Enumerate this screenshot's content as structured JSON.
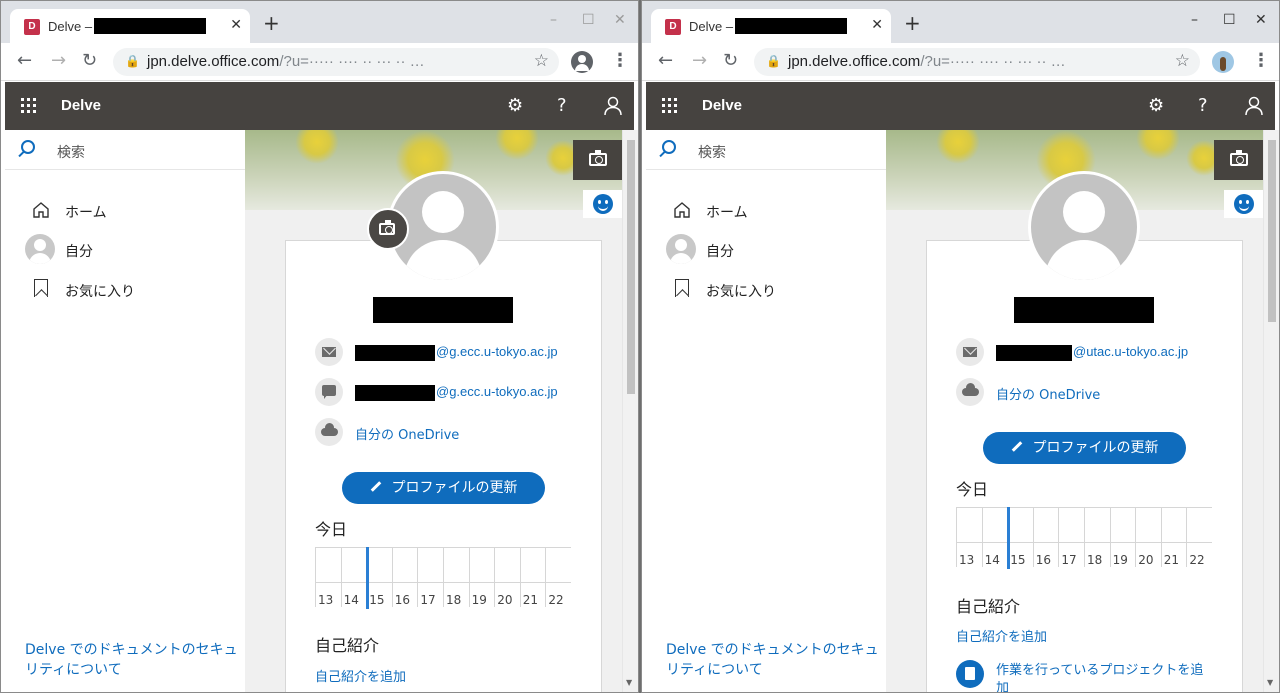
{
  "left": {
    "tab": {
      "title": "Delve –",
      "favicon": "D"
    },
    "address": {
      "host": "jpn.delve.office.com",
      "rest": "/?u=·⁣···· ···· ·· ··· ·· …"
    },
    "appbar": {
      "name": "Delve"
    },
    "nav": {
      "search_placeholder": "検索",
      "home": "ホーム",
      "me": "自分",
      "favorites": "お気に入り",
      "security": "Delve でのドキュメントのセキュリティについて"
    },
    "profile": {
      "email_suffix": "@g.ecc.u-tokyo.ac.jp",
      "chat_suffix": "@g.ecc.u-tokyo.ac.jp",
      "onedrive": "自分の OneDrive",
      "update_button": "プロファイルの更新",
      "today": "今日",
      "timeline": [
        "13",
        "14",
        "15",
        "16",
        "17",
        "18",
        "19",
        "20",
        "21",
        "22"
      ],
      "about_heading": "自己紹介",
      "about_add": "自己紹介を追加"
    }
  },
  "right": {
    "tab": {
      "title": "Delve –",
      "favicon": "D"
    },
    "address": {
      "host": "jpn.delve.office.com",
      "rest": "/?u=····· ···· ·· ··· ·· …"
    },
    "appbar": {
      "name": "Delve"
    },
    "nav": {
      "search_placeholder": "検索",
      "home": "ホーム",
      "me": "自分",
      "favorites": "お気に入り",
      "security": "Delve でのドキュメントのセキュリティについて"
    },
    "profile": {
      "email_suffix": "@utac.u-tokyo.ac.jp",
      "onedrive": "自分の OneDrive",
      "update_button": "プロファイルの更新",
      "today": "今日",
      "timeline": [
        "13",
        "14",
        "15",
        "16",
        "17",
        "18",
        "19",
        "20",
        "21",
        "22"
      ],
      "about_heading": "自己紹介",
      "about_add": "自己紹介を追加",
      "project_text": "作業を行っているプロジェクトを追加"
    }
  },
  "icons": {
    "close": "✕",
    "new_tab": "+",
    "minimize": "–",
    "maximize": "☐",
    "back": "←",
    "forward": "→",
    "reload": "↻",
    "star": "☆",
    "gear": "⚙",
    "help": "?",
    "menu": "⋮"
  },
  "colors": {
    "accent": "#0f6cbd",
    "suitebar": "#464340",
    "favicon": "#c4314b"
  }
}
